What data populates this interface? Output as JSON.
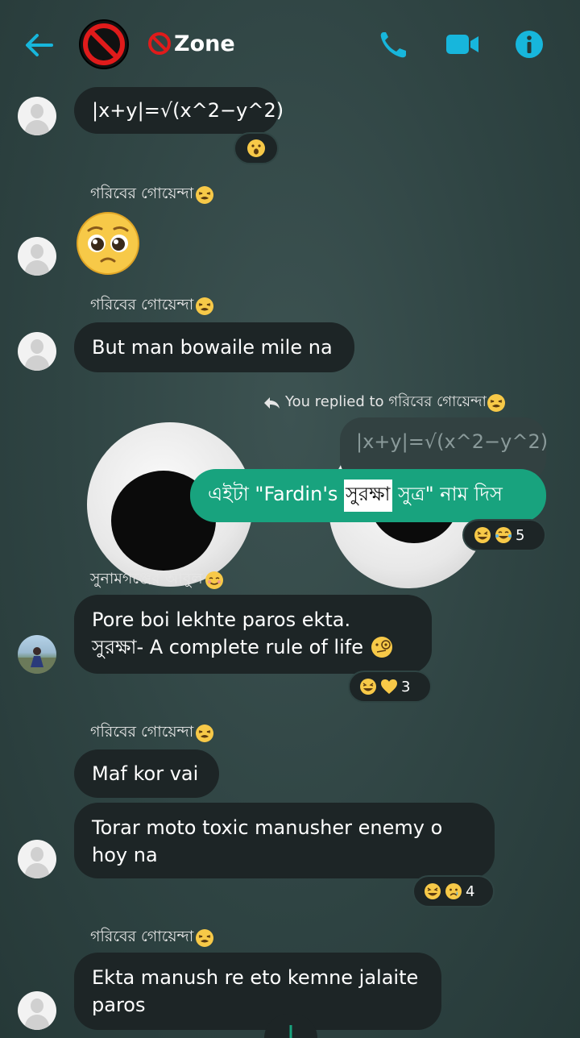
{
  "header": {
    "title": "Zone",
    "accent": "#17b6dc"
  },
  "messages": {
    "m1": {
      "text": "|x+y|=√(x^2−y^2)"
    },
    "m2": {
      "sender": "গরিবের গোয়েন্দা"
    },
    "m3": {
      "sender": "গরিবের গোয়েন্দা",
      "text": "But man bowaile mile na"
    },
    "reply": {
      "label": "You replied to গরিবের গোয়েন্দা",
      "quoted": "|x+y|=√(x^2−y^2)",
      "text_before": "এইটা \"Fardin's ",
      "text_highlight": "সুরক্ষা",
      "text_after": " সুত্র\" নাম দিস",
      "reaction_count": "5"
    },
    "m4": {
      "sender": "সুনামগঞ্জের আবুল",
      "line1": "Pore boi lekhte paros ekta.",
      "line2": "সুরক্ষা- A complete rule of life",
      "reaction_count": "3"
    },
    "m5": {
      "sender": "গরিবের গোয়েন্দা",
      "text1": "Maf kor vai",
      "text2_line1": "Torar moto toxic manusher enemy o",
      "text2_line2": "hoy na",
      "reaction_count": "4"
    },
    "m6": {
      "sender": "গরিবের গোয়েন্দা",
      "line1": "Ekta manush re eto kemne jalaite",
      "line2": "paros"
    }
  },
  "icons": {
    "back": "arrow-left-icon",
    "call": "phone-icon",
    "video": "video-camera-icon",
    "info": "info-icon"
  }
}
